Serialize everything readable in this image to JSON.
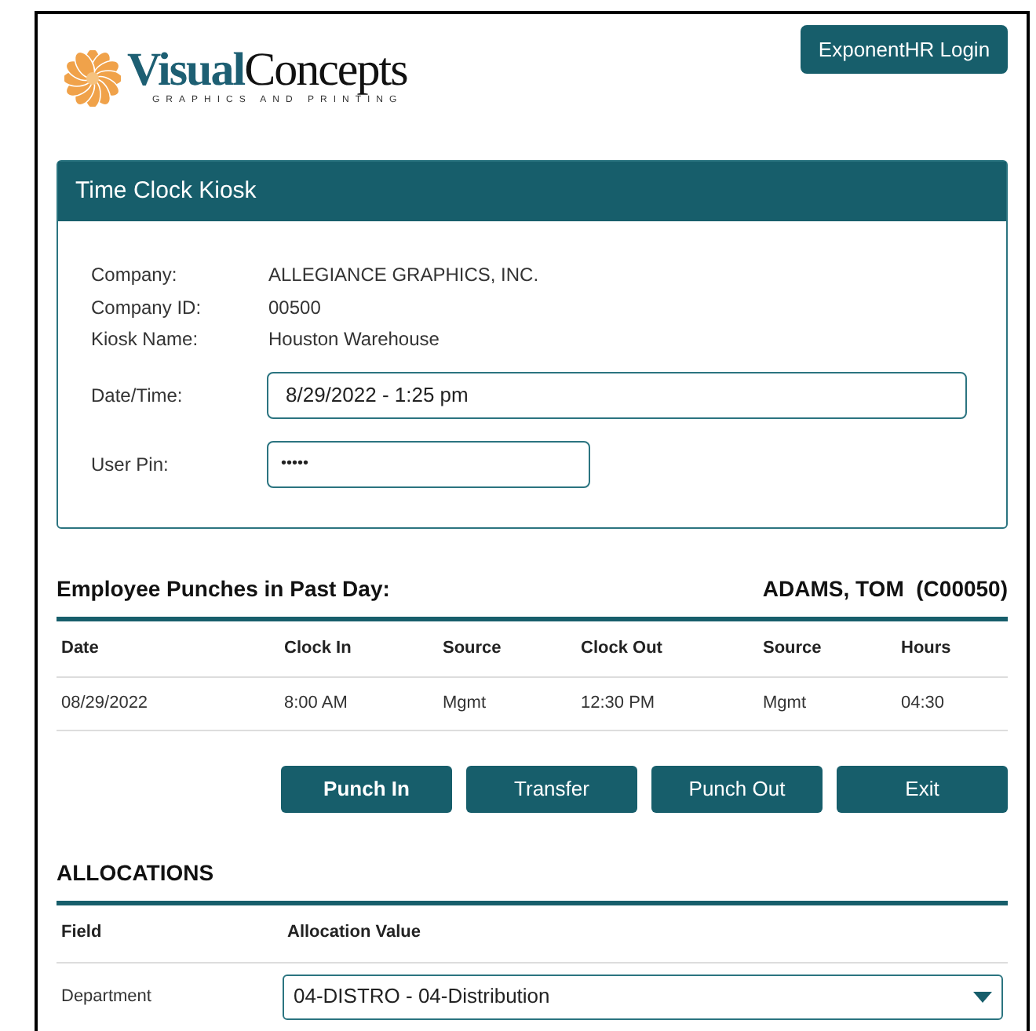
{
  "logo": {
    "name_part1": "Visual",
    "name_part2": "Concepts",
    "tagline": "GRAPHICS AND PRINTING"
  },
  "login_button": "ExponentHR Login",
  "kiosk": {
    "title": "Time Clock Kiosk",
    "info": [
      {
        "label": "Company:",
        "value": "ALLEGIANCE GRAPHICS, INC."
      },
      {
        "label": "Company ID:",
        "value": "00500"
      },
      {
        "label": "Kiosk Name:",
        "value": "Houston Warehouse"
      }
    ],
    "date_time": {
      "label": "Date/Time:",
      "value": "8/29/2022 - 1:25 pm"
    },
    "user_pin": {
      "label": "User Pin:",
      "value": "•••••"
    }
  },
  "punches": {
    "title": "Employee Punches in Past Day:",
    "employee": "ADAMS, TOM  (C00050)",
    "columns": [
      "Date",
      "Clock In",
      "Source",
      "Clock Out",
      "Source",
      "Hours"
    ],
    "rows": [
      [
        "08/29/2022",
        "8:00 AM",
        "Mgmt",
        "12:30 PM",
        "Mgmt",
        "04:30"
      ]
    ]
  },
  "buttons": [
    {
      "label": "Punch In",
      "bold": true
    },
    {
      "label": "Transfer",
      "bold": false
    },
    {
      "label": "Punch Out",
      "bold": false
    },
    {
      "label": "Exit",
      "bold": false
    }
  ],
  "allocations": {
    "title": "ALLOCATIONS",
    "columns": [
      "Field",
      "Allocation Value"
    ],
    "rows": [
      {
        "field": "Department",
        "value": "04-DISTRO - 04-Distribution"
      }
    ]
  }
}
